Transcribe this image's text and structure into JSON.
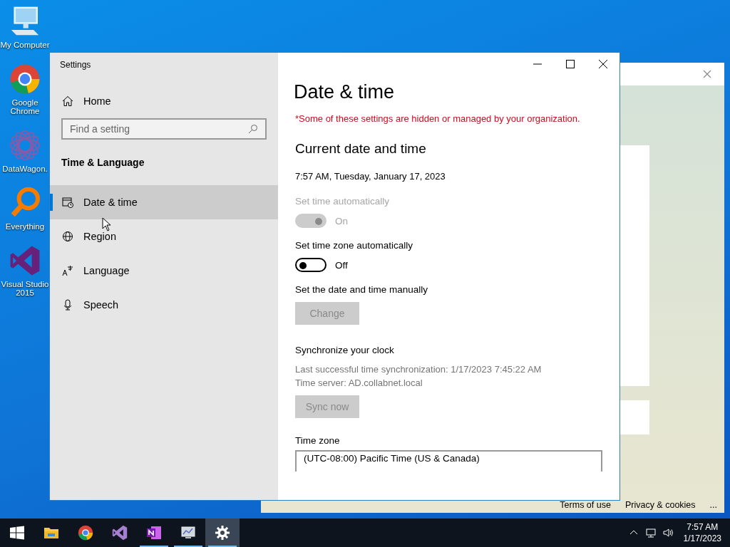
{
  "desktop_icons": [
    {
      "kind": "computer",
      "label": "My Computer"
    },
    {
      "kind": "chrome",
      "label": "Google Chrome"
    },
    {
      "kind": "datawagon",
      "label": "DataWagon."
    },
    {
      "kind": "everything",
      "label": "Everything"
    },
    {
      "kind": "vs",
      "label": "Visual Studio 2015"
    }
  ],
  "background_window": {
    "footer_links": [
      "Terms of use",
      "Privacy & cookies"
    ],
    "more": "..."
  },
  "settings_window": {
    "title": "Settings",
    "home": "Home",
    "search": {
      "placeholder": "Find a setting"
    },
    "section": "Time & Language",
    "nav_items": [
      {
        "kind": "calendar",
        "label": "Date & time",
        "selected": true
      },
      {
        "kind": "globe",
        "label": "Region",
        "selected": false
      },
      {
        "kind": "language",
        "label": "Language",
        "selected": false
      },
      {
        "kind": "mic",
        "label": "Speech",
        "selected": false
      }
    ],
    "page_title": "Date & time",
    "notice": "*Some of these settings are hidden or managed by your organization.",
    "heading": "Current date and time",
    "current": "7:57 AM, Tuesday, January 17, 2023",
    "settings": [
      {
        "kind": "toggle",
        "label": "Set time automatically",
        "on": true,
        "disabled": true,
        "state_label": "On"
      },
      {
        "kind": "toggle",
        "label": "Set time zone automatically",
        "on": false,
        "disabled": false,
        "state_label": "Off"
      },
      {
        "kind": "button",
        "label": "Set the date and time manually",
        "button": "Change",
        "disabled": true
      },
      {
        "kind": "sync",
        "label": "Synchronize your clock",
        "lines": [
          "Last successful time synchronization: 1/17/2023 7:45:22 AM",
          "Time server: AD.collabnet.local"
        ],
        "button": "Sync now",
        "disabled": true
      },
      {
        "kind": "dropdown",
        "label": "Time zone",
        "value": "(UTC-08:00) Pacific Time (US & Canada)"
      }
    ]
  },
  "taskbar": {
    "apps": [
      {
        "kind": "explorer",
        "open": false,
        "active": false
      },
      {
        "kind": "chrome",
        "open": false,
        "active": false
      },
      {
        "kind": "vs",
        "open": false,
        "active": false
      },
      {
        "kind": "onenote",
        "open": true,
        "active": false
      },
      {
        "kind": "monitor",
        "open": true,
        "active": false
      },
      {
        "kind": "gear",
        "open": true,
        "active": true
      }
    ],
    "time": "7:57 AM",
    "date": "1/17/2023"
  }
}
